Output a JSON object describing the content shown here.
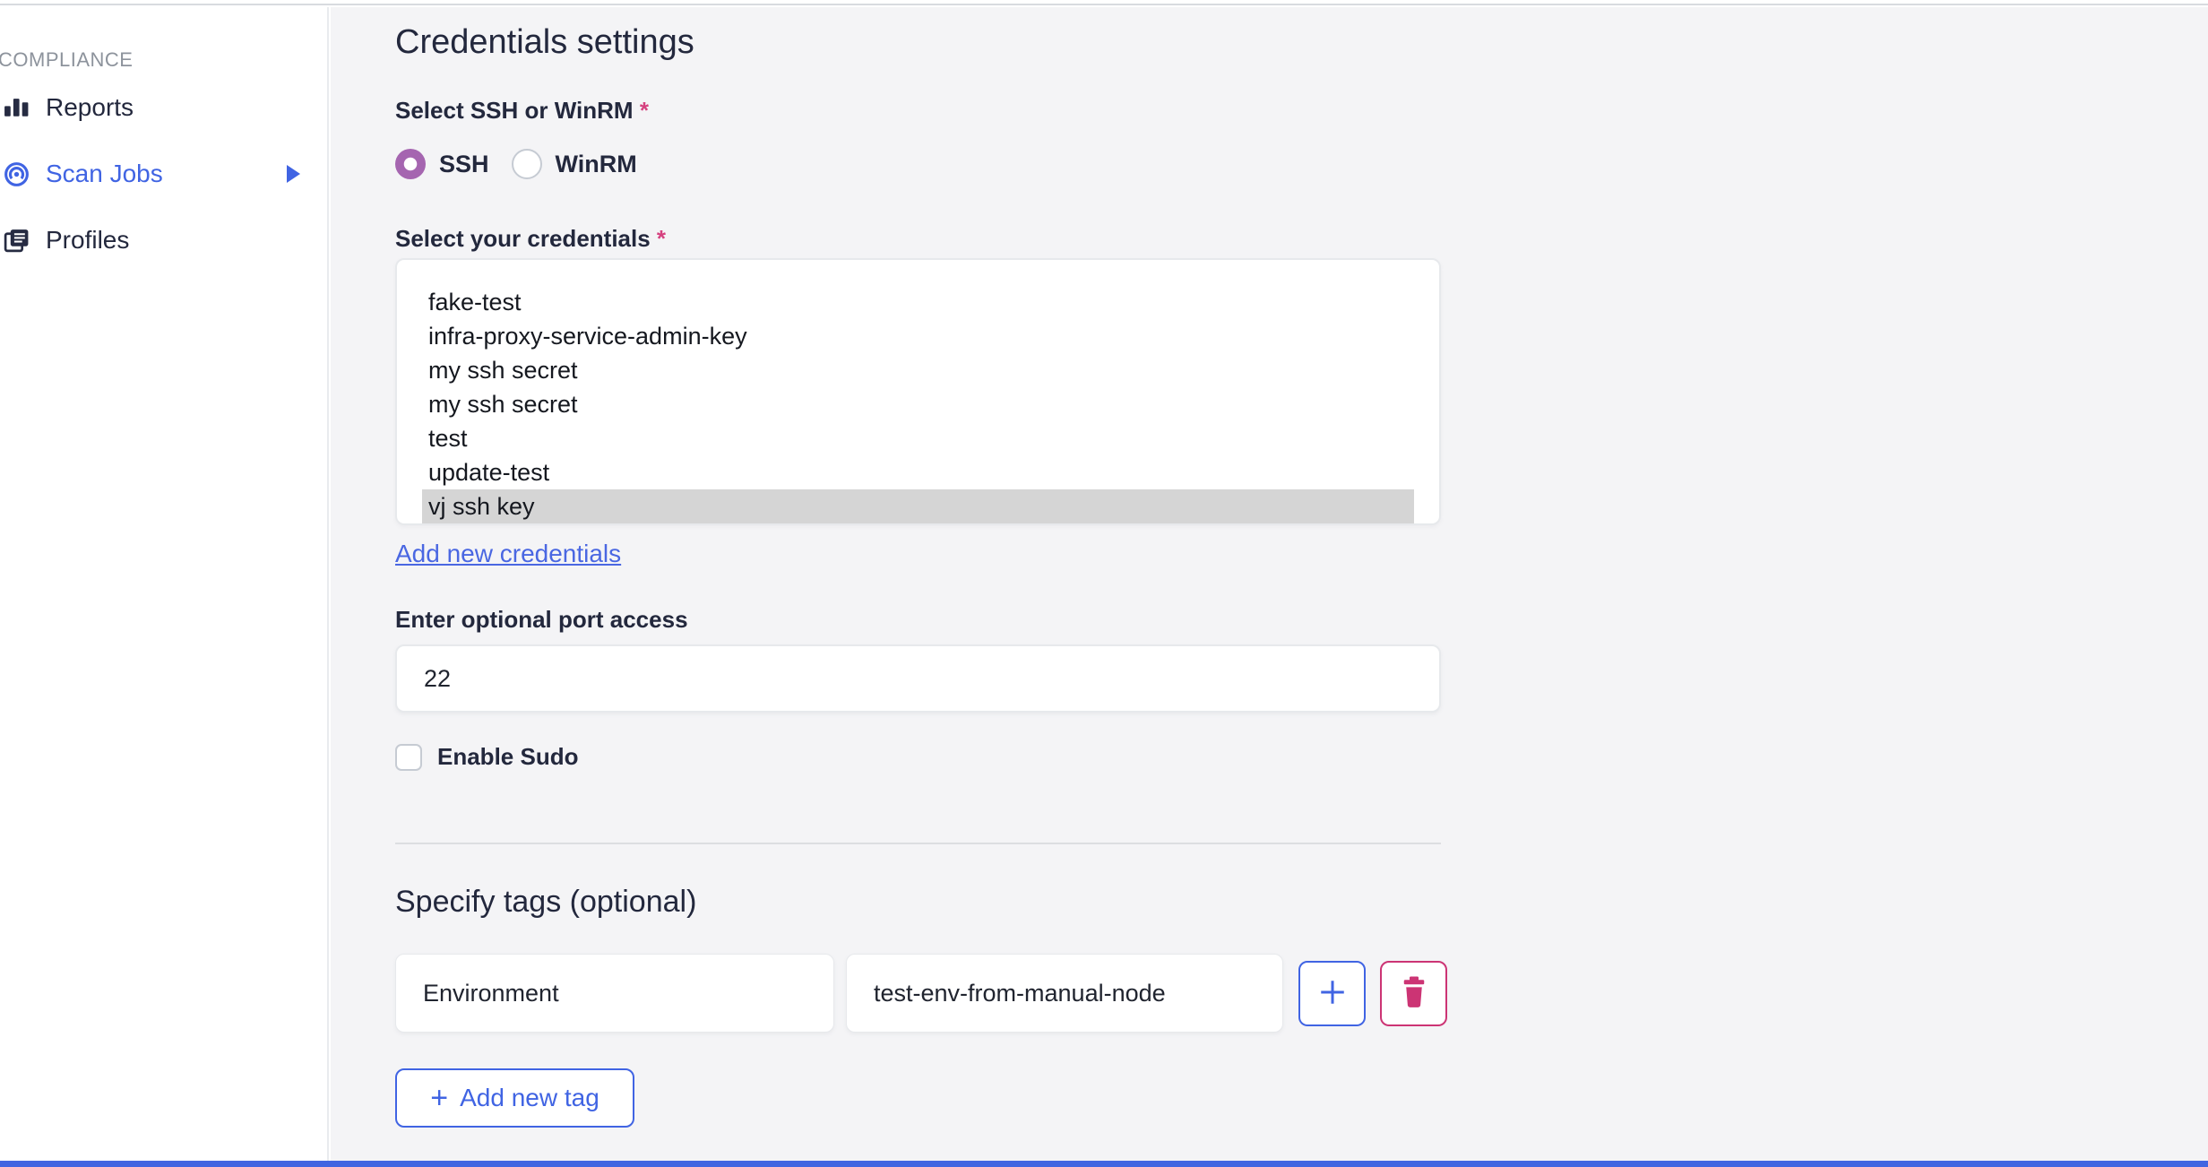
{
  "sidebar": {
    "section_label": "COMPLIANCE",
    "items": [
      {
        "label": "Reports",
        "icon": "bar-chart-icon",
        "active": false
      },
      {
        "label": "Scan Jobs",
        "icon": "radar-icon",
        "active": true,
        "has_submenu": true
      },
      {
        "label": "Profiles",
        "icon": "documents-icon",
        "active": false
      }
    ]
  },
  "main": {
    "title": "Credentials settings",
    "protocol": {
      "label": "Select SSH or WinRM",
      "required": "*",
      "options": [
        {
          "label": "SSH",
          "selected": true
        },
        {
          "label": "WinRM",
          "selected": false
        }
      ]
    },
    "credentials": {
      "label": "Select your credentials",
      "required": "*",
      "options": [
        "fake-test",
        "infra-proxy-service-admin-key",
        "my ssh secret",
        "my ssh secret",
        "test",
        "update-test",
        "vj ssh key"
      ],
      "selected_index": 6,
      "add_link": "Add new credentials"
    },
    "port": {
      "label": "Enter optional port access",
      "value": "22"
    },
    "sudo": {
      "label": "Enable Sudo",
      "checked": false
    },
    "tags": {
      "title": "Specify tags (optional)",
      "rows": [
        {
          "key": "Environment",
          "value": "test-env-from-manual-node"
        }
      ],
      "add_button": {
        "plus": "+",
        "label": "Add new tag"
      }
    }
  },
  "icons": {
    "reports": "bar-chart-icon",
    "scan_jobs": "radar-icon",
    "profiles": "documents-icon",
    "submenu_arrow": "right-triangle",
    "add": "+",
    "delete": "trash-icon"
  },
  "colors": {
    "accent_blue": "#4064e3",
    "bottom_bar_blue": "#4165e1",
    "radio_purple": "#a565b0",
    "danger_pink": "#cc3474",
    "required_pink": "#d5417f",
    "selected_option_bg": "#d5d5d5",
    "content_bg": "#f4f4f6",
    "text_dark": "#23283d"
  }
}
